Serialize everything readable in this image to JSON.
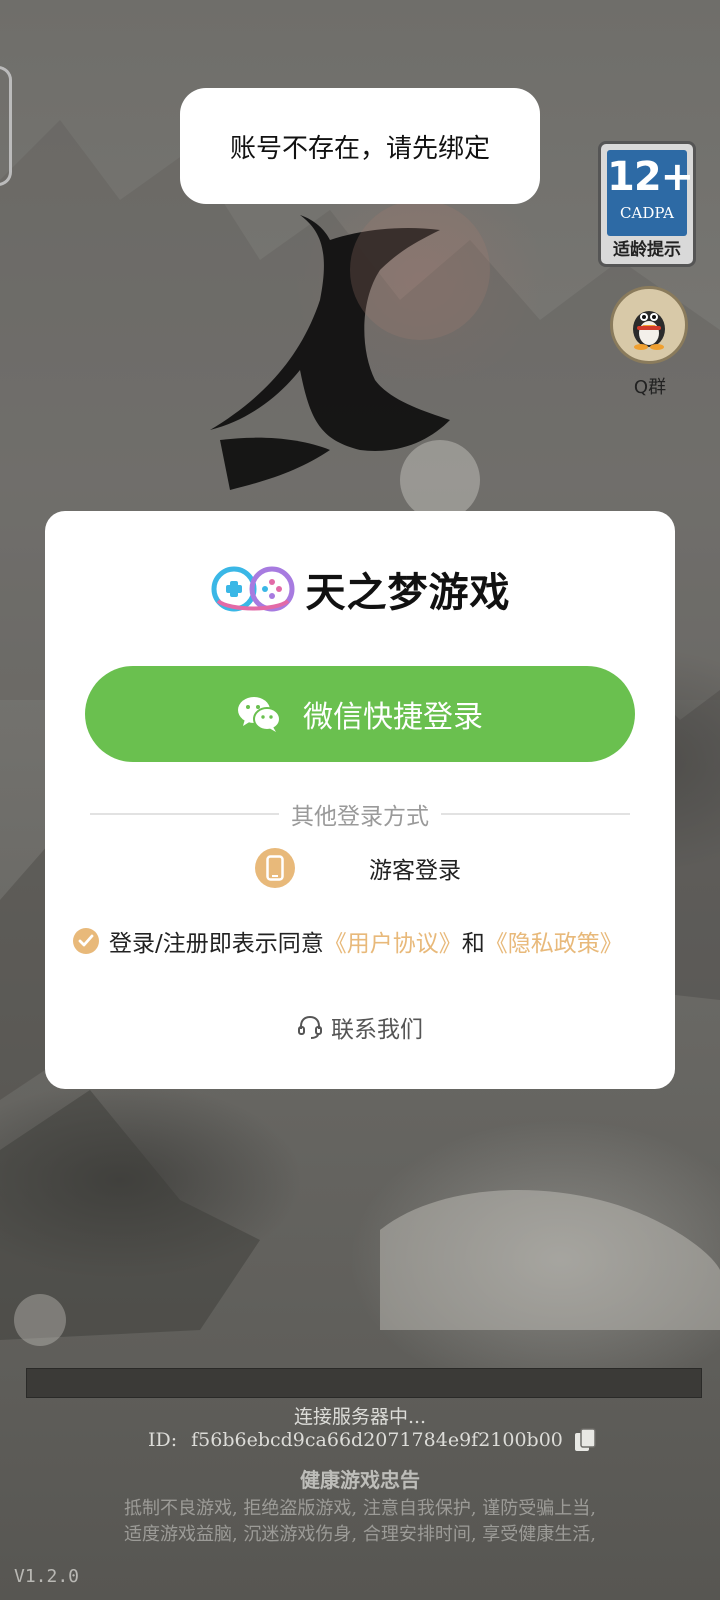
{
  "toast": {
    "message": "账号不存在，请先绑定"
  },
  "age_badge": {
    "rating": "12+",
    "org": "CADPA",
    "tip": "适龄提示"
  },
  "qq_group": {
    "label": "Q群",
    "icon": "qq-penguin-icon"
  },
  "login_card": {
    "brand_name": "天之梦游戏",
    "brand_icon": "gamepad-logo-icon",
    "wechat_button": {
      "label": "微信快捷登录",
      "icon": "wechat-icon",
      "color": "#6ac04f"
    },
    "other_methods_label": "其他登录方式",
    "guest_login": {
      "label": "游客登录",
      "icon": "phone-icon"
    },
    "agreement": {
      "prefix": "登录/注册即表示同意",
      "user_agreement": "《用户协议》",
      "conjunction": "和",
      "privacy_policy": "《隐私政策》",
      "checked": true,
      "accent": "#e8b97a"
    },
    "contact": {
      "label": "联系我们",
      "icon": "headset-icon"
    }
  },
  "footer": {
    "status": "连接服务器中...",
    "id_prefix": "ID:",
    "id_value": "f56b6ebcd9ca66d2071784e9f2100b00",
    "advice_title": "健康游戏忠告",
    "advice_line1": "抵制不良游戏, 拒绝盗版游戏, 注意自我保护, 谨防受骗上当,",
    "advice_line2": "适度游戏益脑, 沉迷游戏伤身, 合理安排时间, 享受健康生活,",
    "version": "V1.2.0"
  }
}
